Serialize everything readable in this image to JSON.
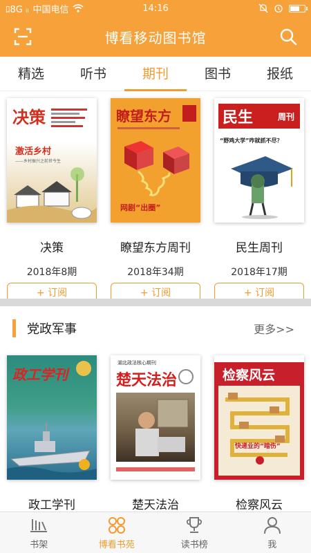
{
  "status_bar": {
    "signal_text": "ﾛ8G  ᵢₗ",
    "carrier": "中国电信",
    "time": "14:16"
  },
  "app_bar": {
    "title": "博看移动图书馆"
  },
  "tabs": [
    {
      "label": "精选"
    },
    {
      "label": "听书"
    },
    {
      "label": "期刊"
    },
    {
      "label": "图书"
    },
    {
      "label": "报纸"
    }
  ],
  "featured": [
    {
      "name": "决策",
      "issue": "2018年8期",
      "subscribe": "+ 订阅",
      "cover_title": "决策",
      "cover_headline": "激活乡村",
      "cover_sub": "——乡村振兴之前世今生"
    },
    {
      "name": "瞭望东方周刊",
      "issue": "2018年34期",
      "subscribe": "+ 订阅",
      "cover_title": "瞭望东方",
      "cover_headline": "网剧“出圈”"
    },
    {
      "name": "民生周刊",
      "issue": "2018年17期",
      "subscribe": "+ 订阅",
      "cover_title": "民生",
      "cover_badge": "周刊",
      "cover_headline": "“野鸡大学”咋就抓不尽？"
    }
  ],
  "section": {
    "title": "党政军事",
    "more": "更多>>"
  },
  "section_books": [
    {
      "name": "政工学刊",
      "cover_title": "政工学刊"
    },
    {
      "name": "楚天法治",
      "cover_title": "楚天法治",
      "cover_header": "湖北政法核心期刊"
    },
    {
      "name": "检察风云",
      "cover_title": "检察风云",
      "cover_headline": "快递业的“暗伤”"
    }
  ],
  "bottom_nav": [
    {
      "label": "书架",
      "icon": "bookshelf-icon"
    },
    {
      "label": "博看书苑",
      "icon": "clover-icon"
    },
    {
      "label": "读书榜",
      "icon": "trophy-icon"
    },
    {
      "label": "我",
      "icon": "person-icon"
    }
  ],
  "colors": {
    "brand": "#f6a13a",
    "accent_text": "#f39a2e"
  }
}
